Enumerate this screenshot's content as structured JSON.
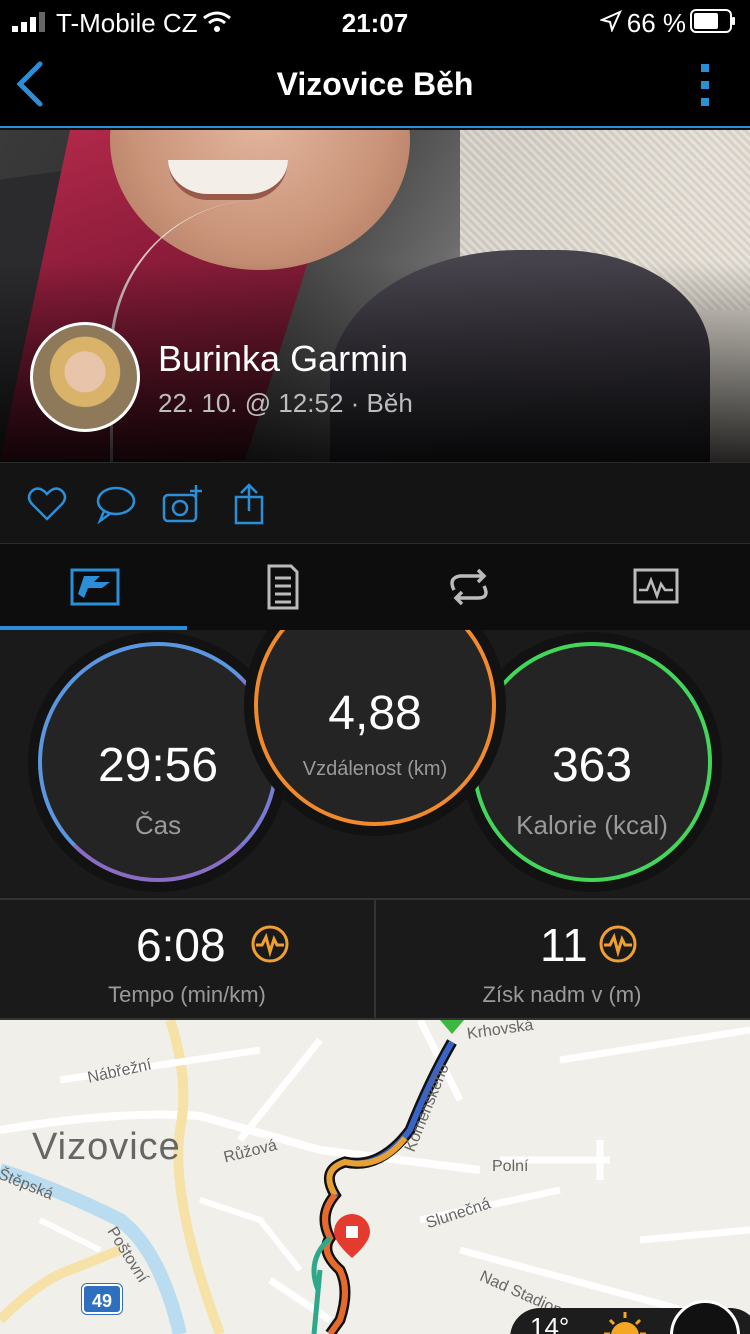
{
  "status_bar": {
    "carrier": "T-Mobile CZ",
    "time": "21:07",
    "battery": "66 %"
  },
  "nav": {
    "title": "Vizovice Běh"
  },
  "activity": {
    "user_name": "Burinka Garmin",
    "meta": "22. 10. @ 12:52 · Běh"
  },
  "actions": [
    "heart-icon",
    "comment-icon",
    "add-photo-icon",
    "share-icon"
  ],
  "tabs": [
    {
      "icon": "overview-icon",
      "active": true
    },
    {
      "icon": "details-icon",
      "active": false
    },
    {
      "icon": "laps-icon",
      "active": false
    },
    {
      "icon": "charts-icon",
      "active": false
    }
  ],
  "stats": {
    "time": {
      "value": "29:56",
      "label": "Čas"
    },
    "distance": {
      "value": "4,88",
      "label": "Vzdálenost (km)"
    },
    "calories": {
      "value": "363",
      "label": "Kalorie (kcal)"
    }
  },
  "metrics": {
    "pace": {
      "value": "6:08",
      "label": "Tempo (min/km)"
    },
    "elevation": {
      "value": "11",
      "label": "Získ nadm v (m)"
    }
  },
  "map": {
    "town": "Vizovice",
    "streets": [
      "Nábřežní",
      "Růžová",
      "Komenského",
      "Krhovská",
      "Polní",
      "Slunečná",
      "Nad Stadionem",
      "Štěpská",
      "Poštovní"
    ],
    "road_number": "49",
    "weather_temp": "14°"
  },
  "colors": {
    "accent": "#2a8fd8",
    "time_ring": "#6f86d6",
    "distance_ring": "#f08a2c",
    "calories_ring": "#42d65a",
    "metric_icon": "#f0a030"
  }
}
